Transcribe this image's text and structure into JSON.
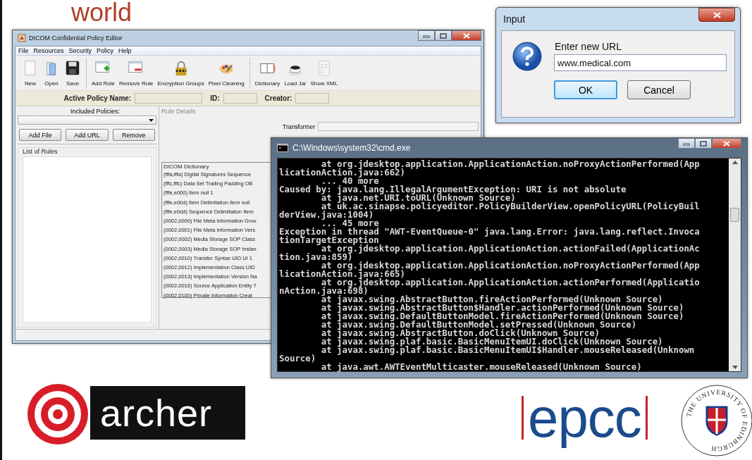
{
  "slide": {
    "heading": "world"
  },
  "editor_window": {
    "title": "DICOM Confidential Policy Editor",
    "menu": [
      "File",
      "Resources",
      "Security",
      "Policy",
      "Help"
    ],
    "toolbar_groups": [
      [
        "New",
        "Open",
        "Save"
      ],
      [
        "Add Rule",
        "Remove Rule",
        "Encryption Groups",
        "Pixel Cleaning"
      ],
      [
        "Dictionary",
        "Load Jar",
        "Show XML"
      ]
    ],
    "policy_fields": [
      {
        "label": "Active Policy Name:"
      },
      {
        "label": "ID:"
      },
      {
        "label": "Creator:"
      }
    ],
    "included_policies_label": "Included Policies:",
    "policy_buttons": [
      "Add File",
      "Add URL",
      "Remove"
    ],
    "rules_panel": {
      "title": "List of Rules"
    },
    "rule_details": {
      "title": "Rule Details",
      "transformer_label": "Transformer"
    },
    "dictionary": {
      "title": "DICOM Dictionary",
      "entries": [
        "(fffa,fffa) Digital Signatures Sequence",
        "(fffc,fffc) Data Set Trailing Padding OB",
        "(fffe,e000) Item  null 1",
        "(fffe,e00d) Item Delimitation Item  null",
        "(fffe,e0dd) Sequence Delimitation Item",
        "(0002,0000) File Meta Information Grou",
        "(0002,0001) File Meta Information Vers",
        "(0002,0002) Media Storage SOP Class",
        "(0002,0003) Media Storage SOP Instan",
        "(0002,0010) Transfer Syntax UID UI 1",
        "(0002,0012) Implementation Class UID",
        "(0002,0013) Implementation Version Na",
        "(0002,0016) Source Application Entity T",
        "(0002,0100) Private Information Creat"
      ]
    }
  },
  "input_dialog": {
    "title": "Input",
    "prompt": "Enter new URL",
    "value": "www.medical.com",
    "buttons": [
      {
        "label": "OK",
        "selected": true
      },
      {
        "label": "Cancel",
        "selected": false
      }
    ]
  },
  "console_window": {
    "title": "C:\\Windows\\system32\\cmd.exe",
    "lines": [
      "        at org.jdesktop.application.ApplicationAction.noProxyActionPerformed(App",
      "licationAction.java:662)",
      "        ... 40 more",
      "Caused by: java.lang.IllegalArgumentException: URI is not absolute",
      "        at java.net.URI.toURL(Unknown Source)",
      "        at uk.ac.sinapse.policyeditor.PolicyBuilderView.openPolicyURL(PolicyBuil",
      "derView.java:1004)",
      "        ... 45 more",
      "Exception in thread \"AWT-EventQueue-0\" java.lang.Error: java.lang.reflect.Invoca",
      "tionTargetException",
      "        at org.jdesktop.application.ApplicationAction.actionFailed(ApplicationAc",
      "tion.java:859)",
      "        at org.jdesktop.application.ApplicationAction.noProxyActionPerformed(App",
      "licationAction.java:665)",
      "        at org.jdesktop.application.ApplicationAction.actionPerformed(Applicatio",
      "nAction.java:698)",
      "        at javax.swing.AbstractButton.fireActionPerformed(Unknown Source)",
      "        at javax.swing.AbstractButton$Handler.actionPerformed(Unknown Source)",
      "        at javax.swing.DefaultButtonModel.fireActionPerformed(Unknown Source)",
      "        at javax.swing.DefaultButtonModel.setPressed(Unknown Source)",
      "        at javax.swing.AbstractButton.doClick(Unknown Source)",
      "        at javax.swing.plaf.basic.BasicMenuItemUI.doClick(Unknown Source)",
      "        at javax.swing.plaf.basic.BasicMenuItemUI$Handler.mouseReleased(Unknown",
      "Source)",
      "        at java.awt.AWTEventMulticaster.mouseReleased(Unknown Source)"
    ]
  },
  "logos": {
    "archer": "archer",
    "epcc": "epcc",
    "university": "THE UNIVERSITY OF EDINBURGH"
  }
}
